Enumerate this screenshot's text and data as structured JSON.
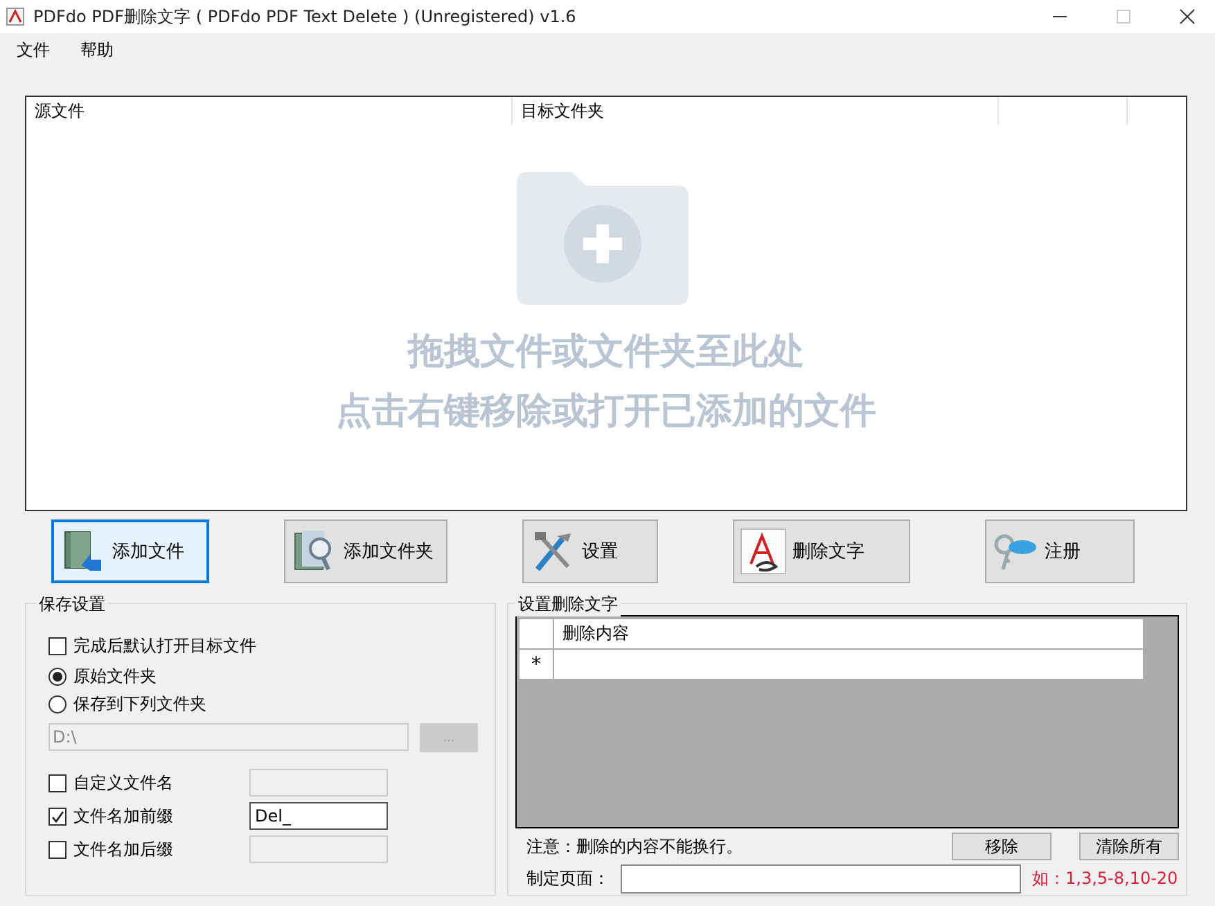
{
  "window": {
    "title": "PDFdo PDF删除文字 ( PDFdo PDF Text Delete ) (Unregistered) v1.6"
  },
  "menu": [
    {
      "label": "文件"
    },
    {
      "label": "帮助"
    }
  ],
  "file_list": {
    "columns": [
      "源文件",
      "目标文件夹"
    ],
    "hints": [
      "拖拽文件或文件夹至此处",
      "点击右键移除或打开已添加的文件"
    ]
  },
  "toolbar": [
    {
      "label": "添加文件",
      "kind": "add-file",
      "focused": true
    },
    {
      "label": "添加文件夹",
      "kind": "add-folder",
      "focused": false
    },
    {
      "label": "设置",
      "kind": "settings",
      "focused": false
    },
    {
      "label": "删除文字",
      "kind": "delete-text",
      "focused": false
    },
    {
      "label": "注册",
      "kind": "register",
      "focused": false
    }
  ],
  "save_settings": {
    "title": "保存设置",
    "open_after": {
      "label": "完成后默认打开目标文件",
      "checked": false
    },
    "destination": [
      {
        "label": "原始文件夹",
        "selected": true
      },
      {
        "label": "保存到下列文件夹",
        "selected": false
      }
    ],
    "folder_path": {
      "value": "D:\\",
      "disabled": true
    },
    "browse_button": {
      "label": "...",
      "disabled": true
    },
    "naming": [
      {
        "label": "自定义文件名",
        "checked": false
      },
      {
        "label": "文件名加前缀",
        "checked": true,
        "value": "Del_"
      },
      {
        "label": "文件名加后缀",
        "checked": false
      }
    ]
  },
  "delete_text": {
    "title": "设置删除文字",
    "table": {
      "columns": [
        "删除内容"
      ],
      "rows": [
        {
          "marker": "*"
        }
      ]
    },
    "note": "注意：删除的内容不能换行。",
    "buttons": [
      "移除",
      "清除所有"
    ],
    "pages": {
      "label": "制定页面：",
      "hint": "如：1,3,5-8,10-20"
    }
  }
}
